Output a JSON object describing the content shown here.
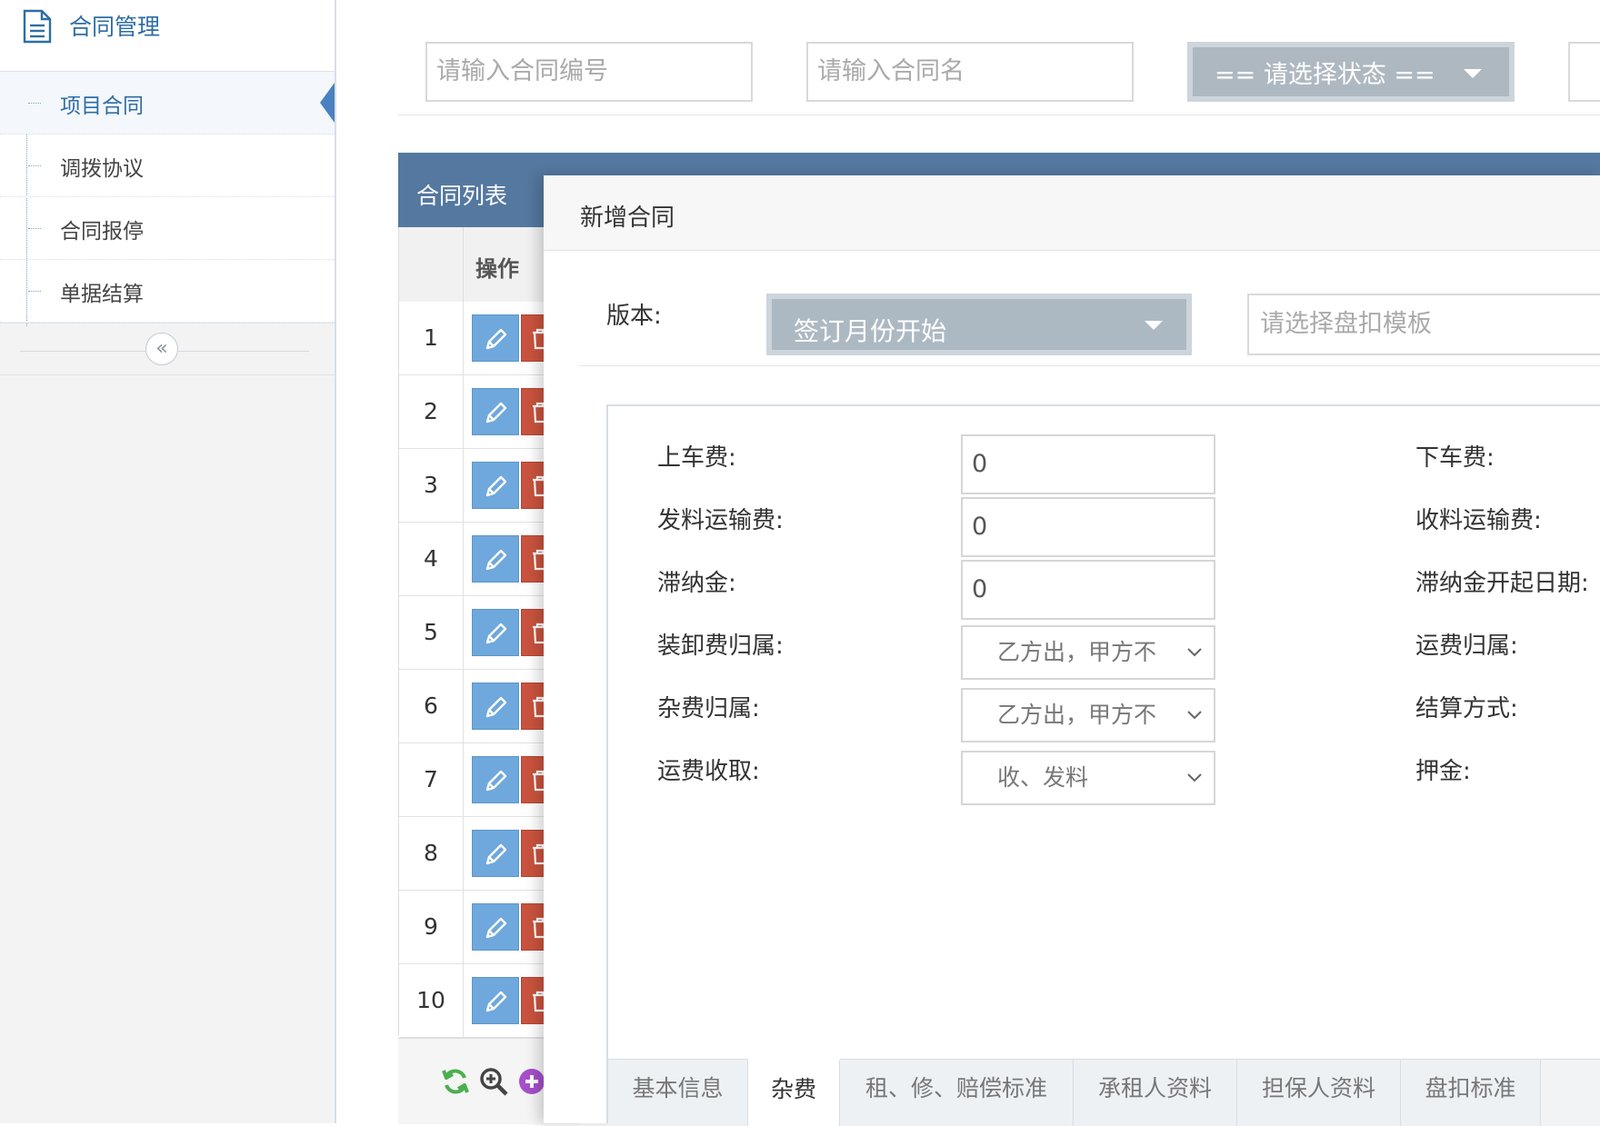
{
  "sidebar": {
    "title": "合同管理",
    "items": [
      {
        "label": "项目合同",
        "active": true
      },
      {
        "label": "调拨协议"
      },
      {
        "label": "合同报停"
      },
      {
        "label": "单据结算"
      }
    ],
    "collapse_icon": "«"
  },
  "filters": {
    "contract_no_placeholder": "请输入合同编号",
    "contract_name_placeholder": "请输入合同名",
    "status_select": "== 请选择状态 =="
  },
  "grid": {
    "title": "合同列表",
    "op_header": "操作",
    "rows": [
      "1",
      "2",
      "3",
      "4",
      "5",
      "6",
      "7",
      "8",
      "9",
      "10"
    ]
  },
  "dialog": {
    "title": "新增合同",
    "version_label": "版本:",
    "version_value": "签订月份开始",
    "template_placeholder": "请选择盘扣模板",
    "fields_left": [
      {
        "label": "上车费:",
        "value": "0"
      },
      {
        "label": "发料运输费:",
        "value": "0"
      },
      {
        "label": "滞纳金:",
        "value": "0"
      },
      {
        "label": "装卸费归属:",
        "value": "乙方出，甲方不"
      },
      {
        "label": "杂费归属:",
        "value": "乙方出，甲方不"
      },
      {
        "label": "运费收取:",
        "value": "收、发料"
      }
    ],
    "fields_right": [
      "下车费:",
      "收料运输费:",
      "滞纳金开起日期:",
      "运费归属:",
      "结算方式:",
      "押金:"
    ],
    "tabs": [
      {
        "label": "基本信息"
      },
      {
        "label": "杂费",
        "active": true
      },
      {
        "label": "租、修、赔偿标准"
      },
      {
        "label": "承租人资料"
      },
      {
        "label": "担保人资料"
      },
      {
        "label": "盘扣标准"
      }
    ]
  },
  "colors": {
    "accent": "#2e6da4",
    "grid_header": "#54789f",
    "edit_button": "#6fa8dc",
    "delete_button": "#c9533e",
    "select_bg": "#adb9c2"
  }
}
